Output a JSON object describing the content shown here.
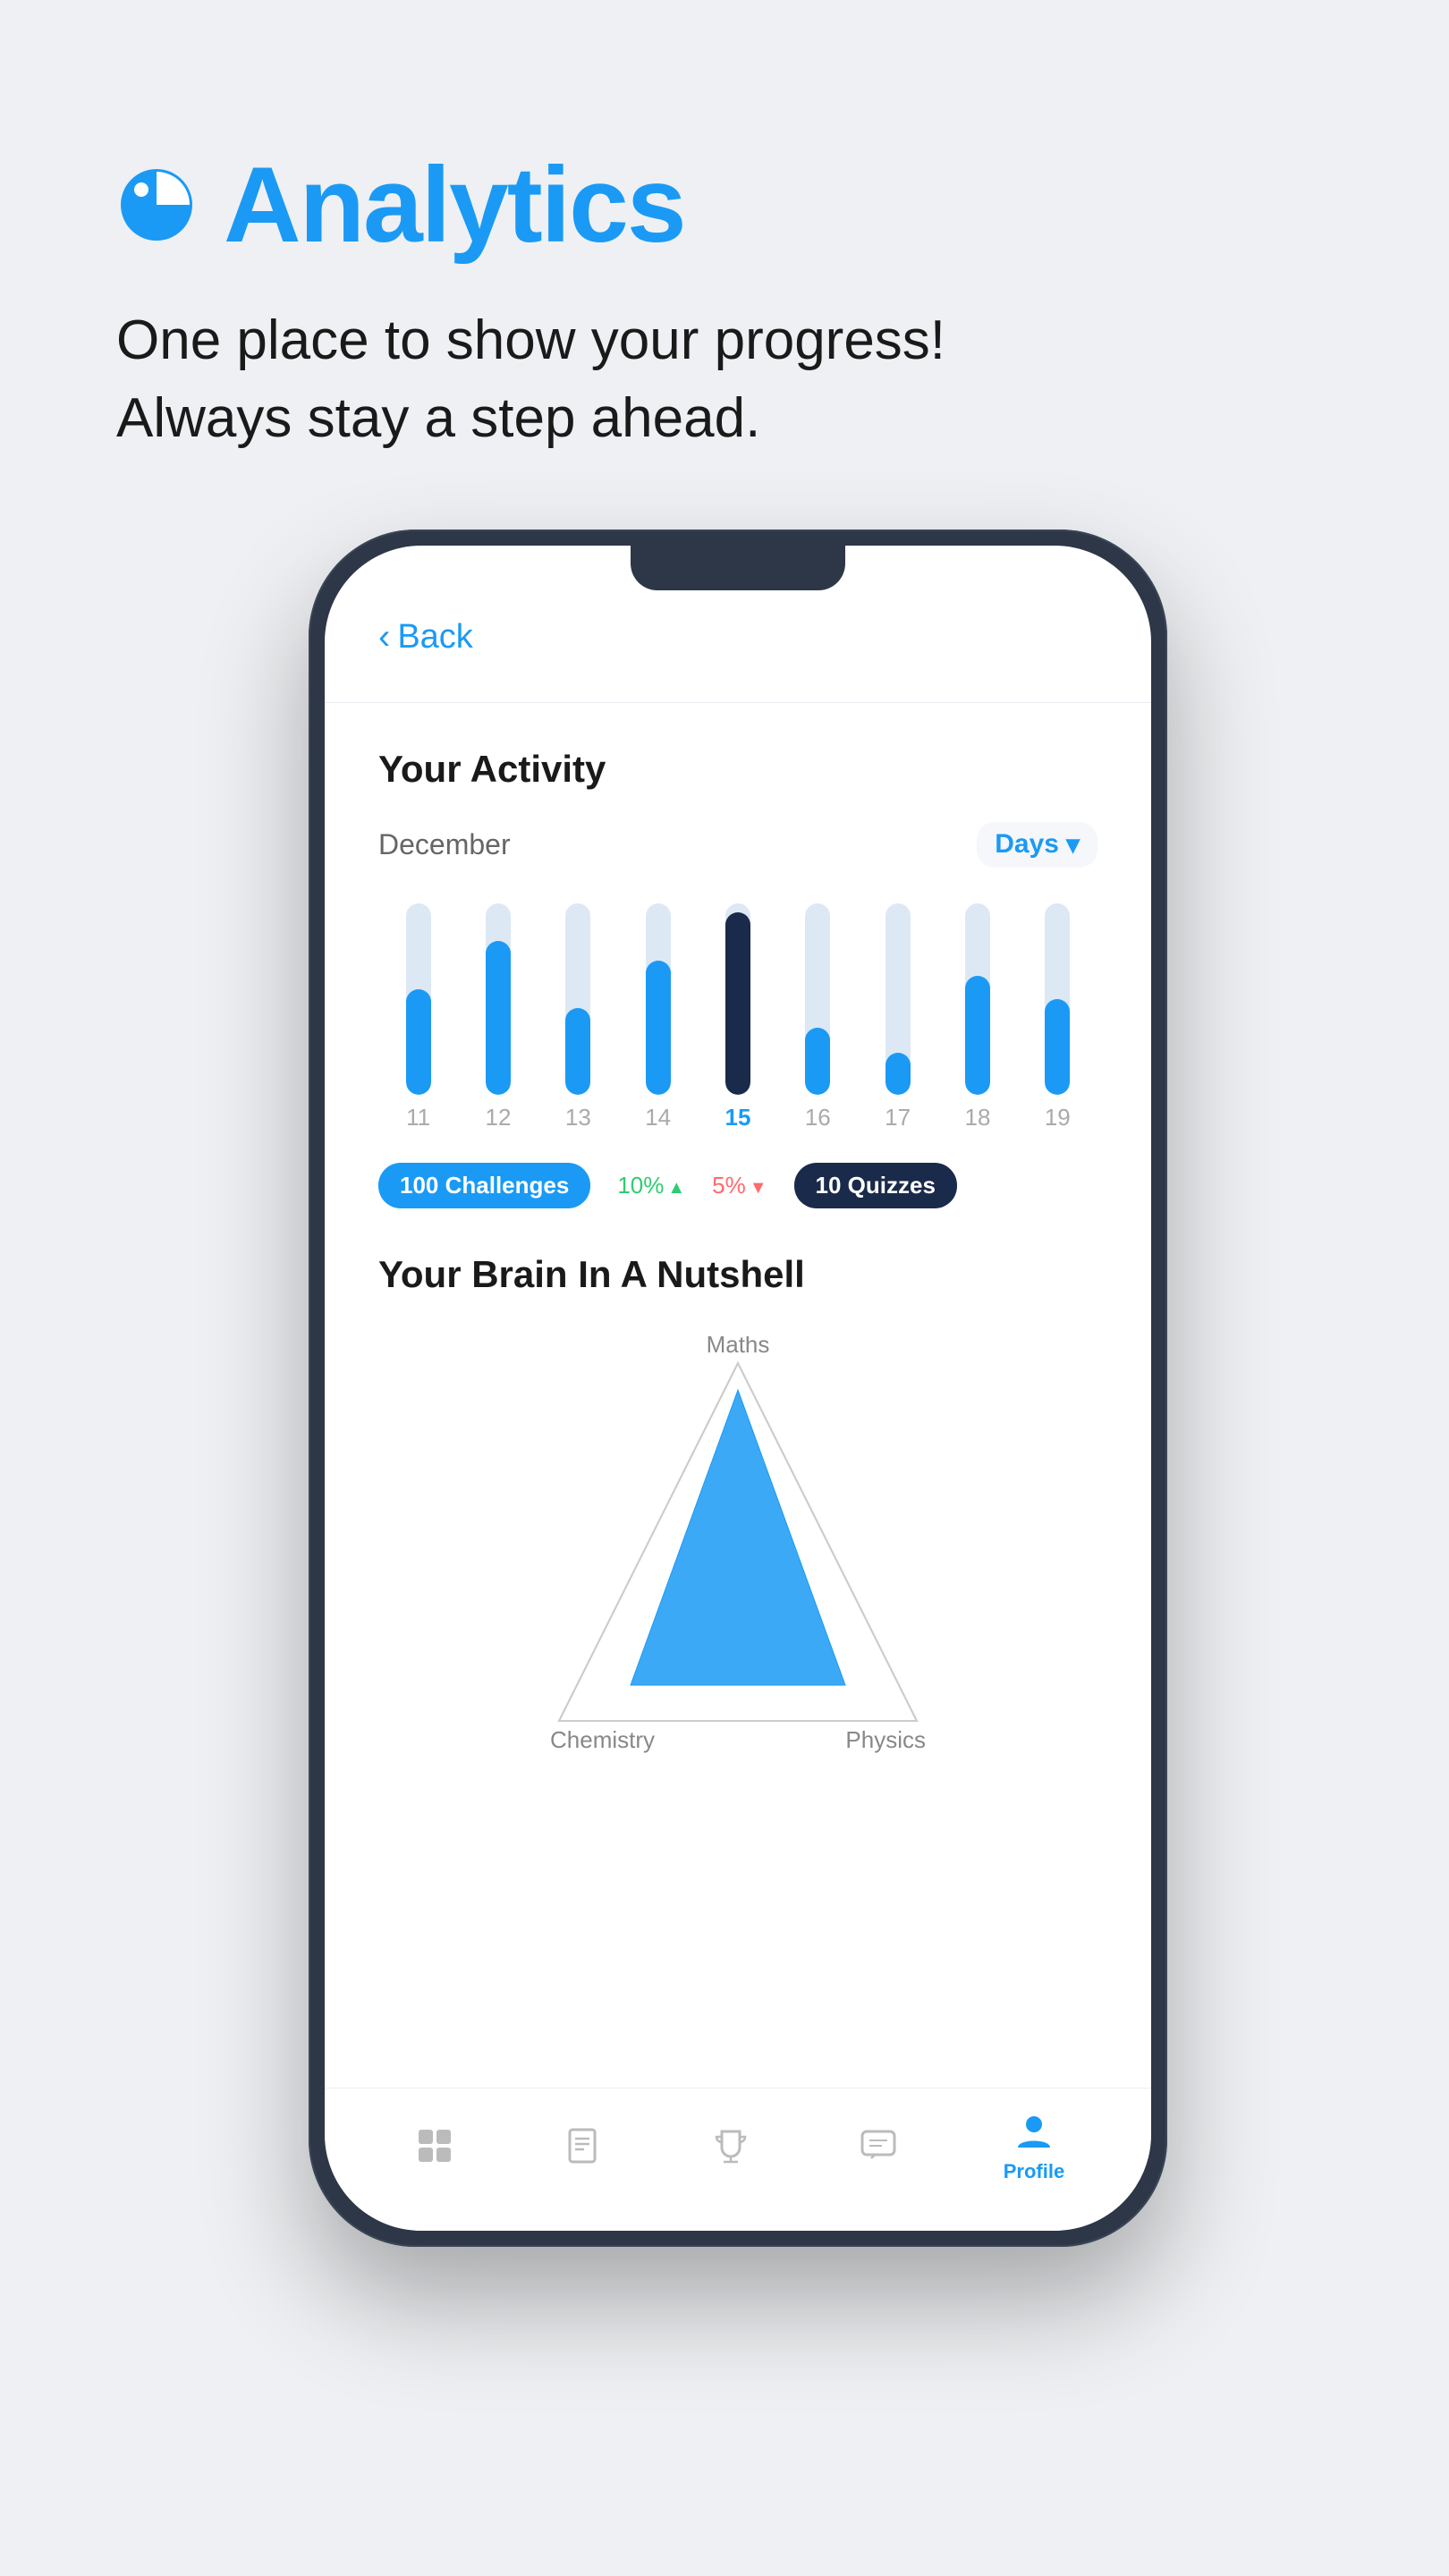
{
  "page": {
    "background": "#eef0f3"
  },
  "header": {
    "icon_name": "analytics-icon",
    "title": "Analytics",
    "subtitle_line1": "One place to show your progress!",
    "subtitle_line2": "Always stay a step ahead."
  },
  "phone": {
    "back_label": "Back",
    "activity_section": {
      "title": "Your Activity",
      "month": "December",
      "filter": "Days",
      "chart_days": [
        "11",
        "12",
        "13",
        "14",
        "15",
        "16",
        "17",
        "18",
        "19"
      ],
      "active_day": "15",
      "stats": [
        {
          "label": "100 Challenges",
          "type": "badge_blue"
        },
        {
          "value": "10%",
          "direction": "up",
          "type": "percent_green"
        },
        {
          "value": "5%",
          "direction": "down",
          "type": "percent_red"
        },
        {
          "label": "10 Quizzes",
          "type": "badge_dark"
        }
      ]
    },
    "nutshell_section": {
      "title": "Your Brain In A Nutshell",
      "radar_labels": {
        "top": "Maths",
        "bottom_left": "Chemistry",
        "bottom_right": "Physics"
      }
    },
    "nav": [
      {
        "icon": "home-icon",
        "label": "",
        "active": false
      },
      {
        "icon": "book-icon",
        "label": "",
        "active": false
      },
      {
        "icon": "trophy-icon",
        "label": "",
        "active": false
      },
      {
        "icon": "chat-icon",
        "label": "",
        "active": false
      },
      {
        "icon": "profile-icon",
        "label": "Profile",
        "active": true
      }
    ]
  }
}
